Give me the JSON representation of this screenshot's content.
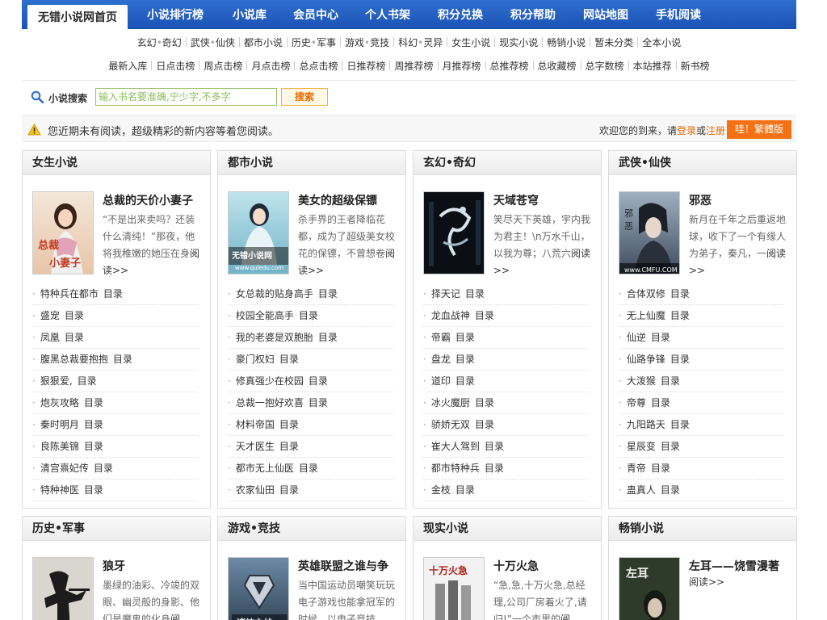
{
  "nav": {
    "items": [
      "无错小说网首页",
      "小说排行榜",
      "小说库",
      "会员中心",
      "个人书架",
      "积分兑换",
      "积分帮助",
      "网站地图",
      "手机阅读"
    ]
  },
  "subnav": {
    "row1": [
      "玄幻",
      "奇幻",
      "武侠",
      "仙侠",
      "都市小说",
      "历史",
      "军事",
      "游戏",
      "竞技",
      "科幻",
      "灵异",
      "女生小说",
      "现实小说",
      "畅销小说",
      "暂未分类",
      "全本小说"
    ],
    "row2": [
      "最新入库",
      "日点击榜",
      "周点击榜",
      "月点击榜",
      "总点击榜",
      "日推荐榜",
      "周推荐榜",
      "月推荐榜",
      "总推荐榜",
      "总收藏榜",
      "总字数榜",
      "本站推荐",
      "新书榜"
    ]
  },
  "search": {
    "label": "小说搜索",
    "placeholder": "输入书名要准确,宁少字,不多字",
    "button": "搜索"
  },
  "notice": {
    "text": "您近期未有阅读，超级精彩的新内容等着您阅读。",
    "welcome": "欢迎您的到来，请",
    "login": "登录",
    "or": "或",
    "register": "注册",
    "trad_button": "哇！繁體版"
  },
  "panels": [
    {
      "title": "女生小说",
      "feature": {
        "title": "总裁的天价小妻子",
        "desc": "“不是出来卖吗？还装什么清纯！”那夜，他将我稚嫩的她压在身",
        "more": "阅读>>"
      },
      "books": [
        "特种兵在都市",
        "盛宠",
        "凤凰",
        "腹黑总裁要抱抱",
        "狠狠爱,",
        "炮灰攻略",
        "秦时明月",
        "良陈美锦",
        "清宫熹妃传",
        "特种神医"
      ]
    },
    {
      "title": "都市小说",
      "feature": {
        "title": "美女的超级保镖",
        "desc": "杀手界的王者降临花都，成为了超级美女校花的保镖，不曾想卷",
        "more": "阅读>>"
      },
      "books": [
        "女总裁的贴身高手",
        "校园全能高手",
        "我的老婆是双胞胎",
        "豪门权妇",
        "修真强少在校园",
        "总裁一抱好欢喜",
        "材料帝国",
        "天才医生",
        "都市无上仙医",
        "农家仙田"
      ]
    },
    {
      "title": "玄幻•奇幻",
      "feature": {
        "title": "天域苍穹",
        "desc": "笑尽天下英雄，宇内我为君主！\\n万水千山，以我为尊；八荒六",
        "more": "阅读>>"
      },
      "books": [
        "择天记",
        "龙血战神",
        "帝霸",
        "盘龙",
        "道印",
        "冰火魔厨",
        "骄娇无双",
        "崔大人驾到",
        "都市特种兵",
        "金枝"
      ]
    },
    {
      "title": "武侠•仙侠",
      "feature": {
        "title": "邪恶",
        "desc": "新月在千年之后重返地球，收下了一个有缘人为弟子，秦凡，一",
        "more": "阅读>>"
      },
      "books": [
        "合体双修",
        "无上仙魔",
        "仙逆",
        "仙路争锋",
        "大泼猴",
        "帝尊",
        "九阳路天",
        "星辰变",
        "青帝",
        "蛊真人"
      ]
    },
    {
      "title": "历史•军事",
      "feature": {
        "title": "狼牙",
        "desc": "墨绿的油彩、冷竣的双眼、幽灵般的身影、他们是魔鬼的化身",
        "more": "阅"
      },
      "books": []
    },
    {
      "title": "游戏•竞技",
      "feature": {
        "title": "英雄联盟之谁与争",
        "desc": "当中国运动员嘲笑玩玩电子游戏也能拿冠军的时候，以电子竞技",
        "more": ""
      },
      "books": []
    },
    {
      "title": "现实小说",
      "feature": {
        "title": "十万火急",
        "desc": "“急,急,十万火急,总经理,公司厂房着火了,请归!”一个市里的",
        "more": "阅"
      },
      "books": []
    },
    {
      "title": "畅销小说",
      "feature": {
        "title": "左耳——饶雪漫著",
        "desc": "",
        "more": "阅读>>"
      },
      "books": []
    }
  ],
  "list_suffix": "目录",
  "covers": [
    "总裁的天价小妻子",
    "无错小说网 www.quledu.com",
    "天域苍穹",
    "邪恶 www.CMFU.COM",
    "狼牙",
    "诸神之战",
    "十万火急",
    "左耳"
  ]
}
